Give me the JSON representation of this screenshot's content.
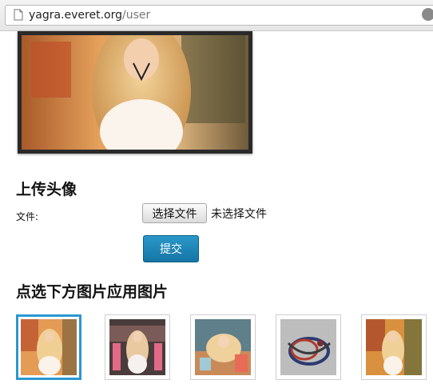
{
  "browser": {
    "url_host": "yagra.everet.org",
    "url_path": "/user"
  },
  "upload": {
    "title": "上传头像",
    "file_label": "文件:",
    "file_button": "选择文件",
    "file_status": "未选择文件",
    "submit": "提交"
  },
  "gallery": {
    "title": "点选下方图片应用图片",
    "items": [
      {
        "name": "thumb-1",
        "selected": true
      },
      {
        "name": "thumb-2",
        "selected": false
      },
      {
        "name": "thumb-3",
        "selected": false
      },
      {
        "name": "thumb-4",
        "selected": false
      },
      {
        "name": "thumb-5",
        "selected": false
      }
    ]
  }
}
